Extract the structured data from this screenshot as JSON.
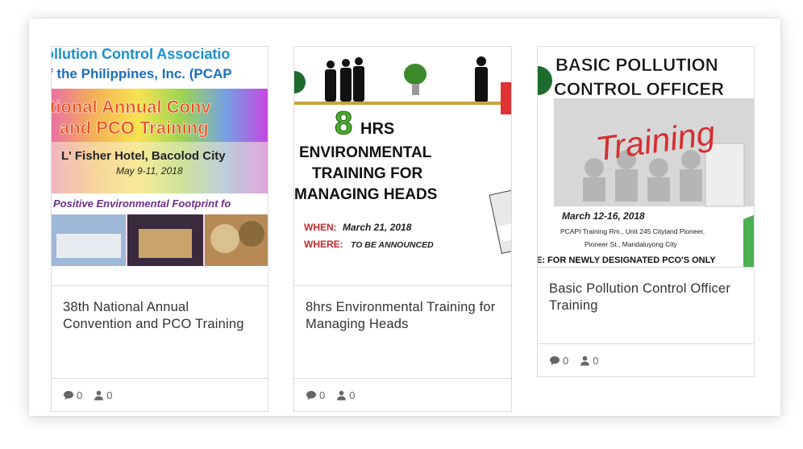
{
  "cards": [
    {
      "title": "38th National Annual Convention and PCO Training",
      "comments": "0",
      "attendees": "0",
      "image": {
        "line1": "ollution Control Associatio",
        "line2": "f the Philippines, Inc. (PCAP",
        "line3": "tional Annual Conv",
        "line4": "and PCO Training",
        "line5": "L' Fisher Hotel, Bacolod City",
        "line6": "May 9-11, 2018",
        "line7": "Positive Environmental Footprint fo"
      }
    },
    {
      "title": "8hrs Environmental Training for Managing Heads",
      "comments": "0",
      "attendees": "0",
      "image": {
        "big": "8",
        "hrs": "HRS",
        "line1": "ENVIRONMENTAL",
        "line2": "TRAINING FOR",
        "line3": "MANAGING HEADS",
        "when_label": "WHEN:",
        "when_value": "March 21, 2018",
        "where_label": "WHERE:",
        "where_value": "TO BE ANNOUNCED"
      }
    },
    {
      "title": "Basic Pollution Control Officer Training",
      "comments": "0",
      "attendees": "0",
      "image": {
        "line1": "BASIC POLLUTION",
        "line2": "CONTROL OFFICER",
        "script": "Training",
        "date": "March 12-16, 2018",
        "venue1": "PCAPI Training Rm., Unit 245 Cityland Pioneer,",
        "venue2": "Pioneer St., Mandaluyong City",
        "note": "E: FOR NEWLY DESIGNATED PCO'S ONLY"
      }
    }
  ],
  "colors": {
    "border": "#dcdcdc",
    "title_text": "#333333",
    "meta_text": "#666666"
  }
}
